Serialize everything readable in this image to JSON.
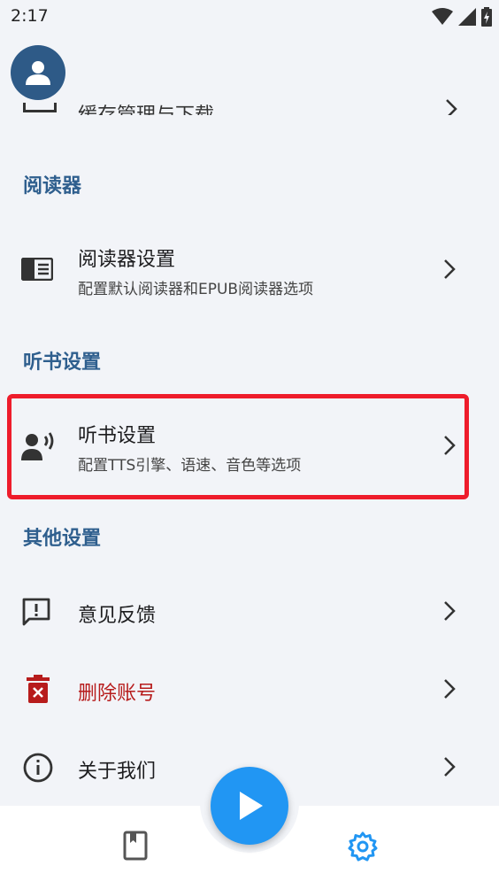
{
  "status_bar": {
    "time": "2:17"
  },
  "clipped_row": {
    "label": "缓存管理与下载"
  },
  "sections": {
    "reader": {
      "title": "阅读器"
    },
    "tts": {
      "title": "听书设置"
    },
    "other": {
      "title": "其他设置"
    }
  },
  "rows": {
    "reader_settings": {
      "title": "阅读器设置",
      "subtitle": "配置默认阅读器和EPUB阅读器选项"
    },
    "tts_settings": {
      "title": "听书设置",
      "subtitle": "配置TTS引擎、语速、音色等选项"
    },
    "feedback": {
      "title": "意见反馈"
    },
    "delete_account": {
      "title": "删除账号"
    },
    "about": {
      "title": "关于我们"
    }
  },
  "colors": {
    "accent": "#2f5f8e",
    "danger": "#b71c1c",
    "fab": "#2196f3",
    "highlight": "#ee1c2b",
    "nav_active": "#2196f3"
  },
  "icons": {
    "avatar": "person-icon",
    "reader": "book-reader-icon",
    "tts": "record-voice-icon",
    "feedback": "feedback-icon",
    "delete": "delete-icon",
    "about": "info-icon",
    "chevron": "chevron-right-icon",
    "fab": "play-icon",
    "nav_library": "bookmark-book-icon",
    "nav_settings": "gear-icon"
  }
}
